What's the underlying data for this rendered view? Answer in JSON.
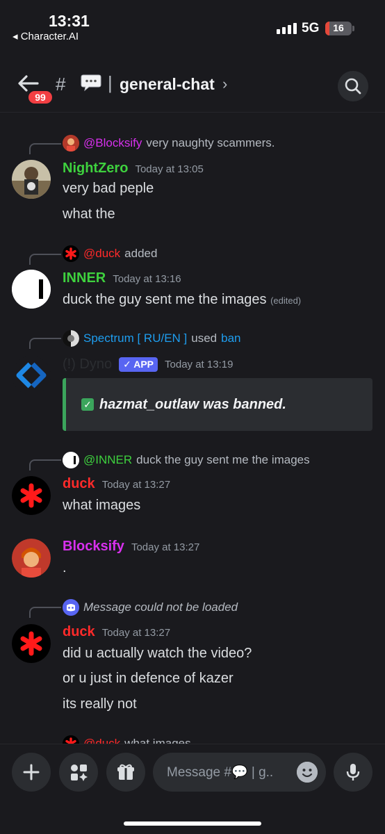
{
  "status": {
    "time": "13:31",
    "back_app": "◂ Character.AI",
    "network": "5G",
    "battery": "16",
    "battery_level": 0.16
  },
  "header": {
    "unread_badge": "99",
    "hash": "#",
    "separator": "|",
    "channel_name": "general-chat",
    "chevron": "›"
  },
  "messages": {
    "m1": {
      "reply_mention": "@Blocksify",
      "reply_text": "very naughty scammers.",
      "author": "NightZero",
      "timestamp": "Today at 13:05",
      "lines": [
        "very bad peple",
        "what the"
      ],
      "author_color": "#3ed13e"
    },
    "m2": {
      "reply_mention": "@duck",
      "reply_text": "added",
      "author": "INNER",
      "timestamp": "Today at 13:16",
      "line": "duck the guy sent me the images",
      "edited": "(edited)",
      "author_color": "#3ed13e"
    },
    "m3": {
      "reply_user": "Spectrum [ RU/EN ]",
      "reply_used": "used",
      "reply_cmd": "ban",
      "author": "(!) Dyno",
      "app_tag": "✓ APP",
      "timestamp": "Today at 13:19",
      "embed_check": "✓",
      "embed_text": "hazmat_outlaw was banned."
    },
    "m4": {
      "reply_mention": "@INNER",
      "reply_text": "duck the guy sent me the images",
      "author": "duck",
      "timestamp": "Today at 13:27",
      "line": "what images",
      "author_color": "#ff2a2a"
    },
    "m5": {
      "author": "Blocksify",
      "timestamp": "Today at 13:27",
      "line": ".",
      "author_color": "#d830ee"
    },
    "m6": {
      "reply_text": "Message could not be loaded",
      "author": "duck",
      "timestamp": "Today at 13:27",
      "lines": [
        "did u actually watch the video?",
        "or u just in defence of kazer",
        "its really not"
      ]
    },
    "m7": {
      "reply_mention": "@duck",
      "reply_text": "what images"
    }
  },
  "composer": {
    "placeholder": "Message #💬 | g.."
  },
  "colors": {
    "background": "#1a1a1e",
    "mention_purple": "#d830ee",
    "mention_red": "#ff2a2a",
    "mention_green": "#3ed13e",
    "link_blue": "#1e9ef0",
    "app_tag": "#5865f2",
    "embed_border": "#3ba55c"
  }
}
